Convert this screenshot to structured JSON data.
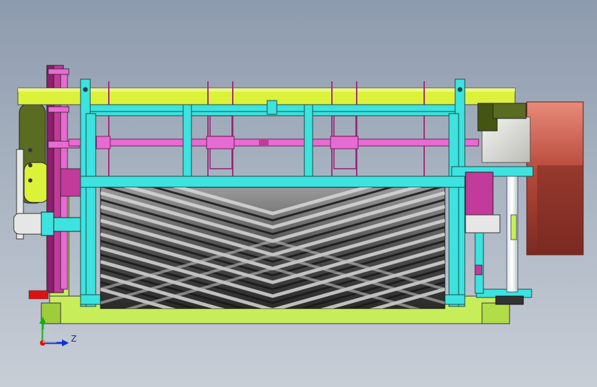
{
  "viewport": {
    "axis_label_z": "Z"
  },
  "colors": {
    "background_top": "#8d9bae",
    "background_bottom": "#c8ced6",
    "frame_cyan": "#3ce3df",
    "bar_yellow": "#dcf23a",
    "base_green": "#c7ee5a",
    "shaft_pink": "#e66bd2",
    "motor_red": "#b84a3a",
    "roller_dark": "#3a3a3a",
    "axis_x_red": "#e01010",
    "axis_y_green": "#10b010",
    "axis_z_blue": "#1030d0"
  }
}
